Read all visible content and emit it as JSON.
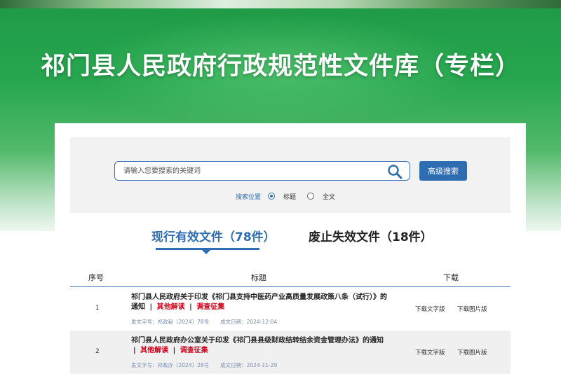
{
  "header": {
    "title": "祁门县人民政府行政规范性文件库（专栏）"
  },
  "search": {
    "placeholder": "请输入您要搜索的关键词",
    "advanced_button": "高级搜索",
    "scope_label": "搜索位置",
    "scope_options": [
      "标题",
      "全文"
    ],
    "scope_selected": "标题"
  },
  "tabs": [
    {
      "label": "现行有效文件（78件）",
      "active": true
    },
    {
      "label": "废止失效文件（18件）",
      "active": false
    }
  ],
  "table": {
    "columns": [
      "序号",
      "标题",
      "下载"
    ],
    "rows": [
      {
        "no": "1",
        "title": "祁门县人民政府关于印发《祁门县支持中医药产业高质量发展政策八条（试行）》的通知",
        "link1": "其他解读",
        "link2": "调查征集",
        "doc_no": "发文字号：祁政秘〔2024〕78号",
        "date": "成文日期：2024-12-04",
        "dl_text": "下载文字版",
        "dl_img": "下载图片版"
      },
      {
        "no": "2",
        "title": "祁门县人民政府办公室关于印发《祁门县县级财政结转结余资金管理办法》的通知",
        "link1": "其他解读",
        "link2": "调查征集",
        "doc_no": "发文字号：祁政办〔2024〕28号",
        "date": "成文日期：2024-11-29",
        "dl_text": "下载文字版",
        "dl_img": "下载图片版"
      }
    ]
  },
  "colors": {
    "brand_green": "#27a64f",
    "accent_blue": "#2f6db3",
    "link_red": "#d0021b"
  }
}
